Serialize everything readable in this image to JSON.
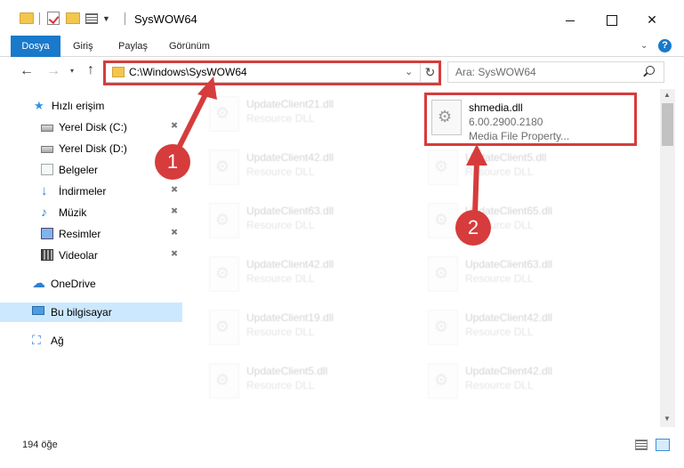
{
  "window": {
    "title": "SysWOW64",
    "minimize_label": "",
    "maximize_label": "",
    "close_label": "✕"
  },
  "ribbon": {
    "tabs": [
      "Dosya",
      "Giriş",
      "Paylaş",
      "Görünüm"
    ],
    "expand_glyph": "⌄",
    "help_glyph": "?"
  },
  "navigation": {
    "back_glyph": "←",
    "forward_glyph": "→",
    "recent_glyph": "▾",
    "up_glyph": "↑",
    "address_path": "C:\\Windows\\SysWOW64",
    "address_dropdown_glyph": "⌄",
    "refresh_glyph": "↻",
    "search_placeholder": "Ara: SysWOW64"
  },
  "sidebar": {
    "items": [
      {
        "label": "Hızlı erişim",
        "icon": "quick-access-star-icon"
      },
      {
        "label": "Yerel Disk (C:)",
        "icon": "drive-icon",
        "pinned": true
      },
      {
        "label": "Yerel Disk (D:)",
        "icon": "drive-icon"
      },
      {
        "label": "Belgeler",
        "icon": "documents-icon"
      },
      {
        "label": "İndirmeler",
        "icon": "downloads-icon",
        "pinned": true
      },
      {
        "label": "Müzik",
        "icon": "music-icon",
        "pinned": true
      },
      {
        "label": "Resimler",
        "icon": "pictures-icon",
        "pinned": true
      },
      {
        "label": "Videolar",
        "icon": "videos-icon",
        "pinned": true
      },
      {
        "label": "OneDrive",
        "icon": "onedrive-cloud-icon"
      },
      {
        "label": "Bu bilgisayar",
        "icon": "this-pc-icon",
        "selected": true
      },
      {
        "label": "Ağ",
        "icon": "network-icon"
      }
    ],
    "pin_glyph": "📌"
  },
  "files": [
    {
      "name": "UpdateClient21.dll",
      "type": "Resource DLL"
    },
    {
      "name": "shmedia.dll",
      "version": "6.00.2900.2180",
      "description": "Media File Property..."
    },
    {
      "name": "UpdateClient42.dll",
      "type": "Resource DLL"
    },
    {
      "name": "UpdateClient5.dll",
      "type": "Resource DLL"
    },
    {
      "name": "UpdateClient63.dll",
      "type": "Resource DLL"
    },
    {
      "name": "UpdateClient65.dll",
      "type": "Resource DLL"
    },
    {
      "name": "UpdateClient42.dll",
      "type": "Resource DLL"
    },
    {
      "name": "UpdateClient63.dll",
      "type": "Resource DLL"
    },
    {
      "name": "UpdateClient19.dll",
      "type": "Resource DLL"
    },
    {
      "name": "UpdateClient42.dll",
      "type": "Resource DLL"
    },
    {
      "name": "UpdateClient5.dll",
      "type": "Resource DLL"
    },
    {
      "name": "UpdateClient42.dll",
      "type": "Resource DLL"
    }
  ],
  "status": {
    "item_count": "194 öğe"
  },
  "annotations": {
    "callout_1": "1",
    "callout_2": "2",
    "highlight_color": "#d63c3c"
  },
  "scrollbar": {
    "up_glyph": "▲",
    "down_glyph": "▼"
  }
}
